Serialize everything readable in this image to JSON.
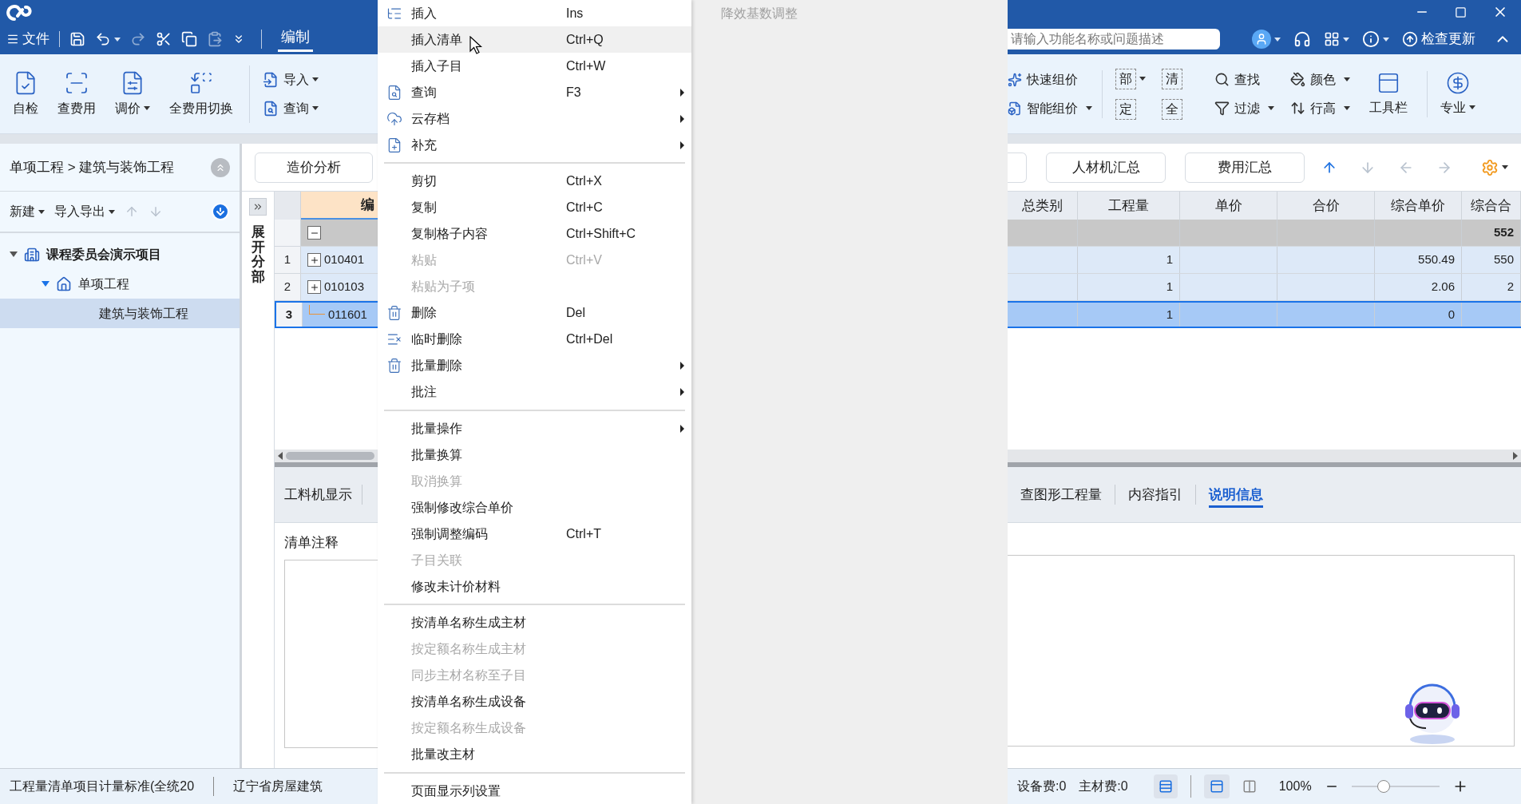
{
  "title_bar": {
    "file_menu": "文件",
    "tabs": [
      {
        "label": "编制",
        "selected": true
      }
    ],
    "search": {
      "placeholder": "请输入功能名称或问题描述"
    },
    "update_label": "检查更新"
  },
  "ribbon_left": {
    "large": [
      {
        "label": "自检",
        "dropdown": false
      },
      {
        "label": "查费用",
        "dropdown": false
      },
      {
        "label": "调价",
        "dropdown": true
      },
      {
        "label": "全费用切换",
        "dropdown": false
      }
    ],
    "small": [
      {
        "label": "导入",
        "dropdown": true
      },
      {
        "label": "查询",
        "dropdown": true
      }
    ]
  },
  "ribbon_right": {
    "small": [
      {
        "label": "快速组价",
        "dropdown": false
      },
      {
        "label": "智能组价",
        "dropdown": true
      }
    ],
    "glyphs": [
      {
        "label": "部",
        "dropdown": true
      },
      {
        "label": "清",
        "dropdown": false
      },
      {
        "label": "定",
        "dropdown": false
      },
      {
        "label": "全",
        "dropdown": false
      }
    ],
    "tools": [
      {
        "label": "查找",
        "dropdown": false
      },
      {
        "label": "颜色",
        "dropdown": true
      },
      {
        "label": "过滤",
        "dropdown": true
      },
      {
        "label": "行高",
        "dropdown": true
      }
    ],
    "large": [
      {
        "label": "工具栏",
        "dropdown": false
      },
      {
        "label": "专业",
        "dropdown": true
      }
    ]
  },
  "project_panel": {
    "breadcrumb": "单项工程 > 建筑与装饰工程",
    "toolbar": [
      {
        "label": "新建"
      },
      {
        "label": "导入导出"
      }
    ],
    "tree": [
      {
        "label": "课程委员会演示项目",
        "expanded": true,
        "selected": false,
        "children": [
          {
            "label": "单项工程",
            "expanded": true,
            "selected": false,
            "children": [
              {
                "label": "建筑与装饰工程",
                "selected": true
              }
            ]
          }
        ]
      }
    ]
  },
  "analysis_button": "造价分析",
  "expand_label": "展开分部",
  "summary_buttons": [
    "人材机汇总",
    "费用汇总"
  ],
  "grid": {
    "columns": {
      "code": "编",
      "category": "总类别",
      "qty": "工程量",
      "unit_price": "单价",
      "total": "合价",
      "composite_unit_price": "综合单价",
      "composite_total": "综合合"
    },
    "rows": [
      {
        "kind": "section",
        "expanded": true,
        "selected": false,
        "composite_total": "552"
      },
      {
        "kind": "item",
        "num": "1",
        "code": "010401",
        "expanded": false,
        "selected": false,
        "qty": "1",
        "composite_unit_price": "550.49",
        "composite_total": "550"
      },
      {
        "kind": "item",
        "num": "2",
        "code": "010103",
        "expanded": false,
        "selected": false,
        "qty": "1",
        "composite_unit_price": "2.06",
        "composite_total": "2"
      },
      {
        "kind": "item",
        "num": "3",
        "code": "011601",
        "selected": true,
        "qty": "1",
        "composite_unit_price": "0"
      }
    ]
  },
  "context_menu": [
    {
      "kind": "item",
      "label": "插入",
      "shortcut": "Ins",
      "disabled": false,
      "submenu": false,
      "selected": false
    },
    {
      "kind": "item",
      "label": "插入清单",
      "shortcut": "Ctrl+Q",
      "disabled": false,
      "submenu": false,
      "selected": true
    },
    {
      "kind": "item",
      "label": "插入子目",
      "shortcut": "Ctrl+W",
      "disabled": false,
      "submenu": false,
      "selected": false
    },
    {
      "kind": "item",
      "label": "查询",
      "shortcut": "F3",
      "disabled": false,
      "submenu": true,
      "selected": false
    },
    {
      "kind": "item",
      "label": "云存档",
      "disabled": false,
      "submenu": true,
      "selected": false
    },
    {
      "kind": "item",
      "label": "补充",
      "disabled": false,
      "submenu": true,
      "selected": false
    },
    {
      "kind": "separator"
    },
    {
      "kind": "item",
      "label": "剪切",
      "shortcut": "Ctrl+X",
      "disabled": false,
      "submenu": false,
      "selected": false
    },
    {
      "kind": "item",
      "label": "复制",
      "shortcut": "Ctrl+C",
      "disabled": false,
      "submenu": false,
      "selected": false
    },
    {
      "kind": "item",
      "label": "复制格子内容",
      "shortcut": "Ctrl+Shift+C",
      "disabled": false,
      "submenu": false,
      "selected": false
    },
    {
      "kind": "item",
      "label": "粘贴",
      "shortcut": "Ctrl+V",
      "disabled": true,
      "submenu": false,
      "selected": false
    },
    {
      "kind": "item",
      "label": "粘贴为子项",
      "disabled": true,
      "submenu": false,
      "selected": false
    },
    {
      "kind": "item",
      "label": "删除",
      "shortcut": "Del",
      "disabled": false,
      "submenu": false,
      "selected": false
    },
    {
      "kind": "item",
      "label": "临时删除",
      "shortcut": "Ctrl+Del",
      "disabled": false,
      "submenu": false,
      "selected": false
    },
    {
      "kind": "item",
      "label": "批量删除",
      "disabled": false,
      "submenu": true,
      "selected": false
    },
    {
      "kind": "item",
      "label": "批注",
      "disabled": false,
      "submenu": true,
      "selected": false
    },
    {
      "kind": "separator"
    },
    {
      "kind": "item",
      "label": "批量操作",
      "disabled": false,
      "submenu": true,
      "selected": false
    },
    {
      "kind": "item",
      "label": "批量换算",
      "disabled": false,
      "submenu": false,
      "selected": false
    },
    {
      "kind": "item",
      "label": "取消换算",
      "disabled": true,
      "submenu": false,
      "selected": false
    },
    {
      "kind": "item",
      "label": "强制修改综合单价",
      "disabled": false,
      "submenu": false,
      "selected": false
    },
    {
      "kind": "item",
      "label": "强制调整编码",
      "shortcut": "Ctrl+T",
      "disabled": false,
      "submenu": false,
      "selected": false
    },
    {
      "kind": "item",
      "label": "子目关联",
      "disabled": true,
      "submenu": false,
      "selected": false
    },
    {
      "kind": "item",
      "label": "修改未计价材料",
      "disabled": false,
      "submenu": false,
      "selected": false
    },
    {
      "kind": "separator"
    },
    {
      "kind": "item",
      "label": "按清单名称生成主材",
      "disabled": false,
      "submenu": false,
      "selected": false
    },
    {
      "kind": "item",
      "label": "按定额名称生成主材",
      "disabled": true,
      "submenu": false,
      "selected": false
    },
    {
      "kind": "item",
      "label": "同步主材名称至子目",
      "disabled": true,
      "submenu": false,
      "selected": false
    },
    {
      "kind": "item",
      "label": "按清单名称生成设备",
      "disabled": false,
      "submenu": false,
      "selected": false
    },
    {
      "kind": "item",
      "label": "按定额名称生成设备",
      "disabled": true,
      "submenu": false,
      "selected": false
    },
    {
      "kind": "item",
      "label": "批量改主材",
      "disabled": false,
      "submenu": false,
      "selected": false
    },
    {
      "kind": "separator"
    },
    {
      "kind": "item",
      "label": "页面显示列设置",
      "disabled": false,
      "submenu": false,
      "selected": false
    }
  ],
  "side_menu": {
    "label": "降效基数调整",
    "disabled": true
  },
  "bottom_tabs_left": [
    {
      "label": "工料机显示",
      "selected": false
    }
  ],
  "bottom_tabs_right": [
    {
      "label": "查图形工程量",
      "selected": false
    },
    {
      "label": "内容指引",
      "selected": false
    },
    {
      "label": "说明信息",
      "selected": true
    }
  ],
  "note_label": "清单注释",
  "status_bar": {
    "left": [
      "工程量清单项目计量标准(全统20",
      "辽宁省房屋建筑"
    ],
    "right": [
      "设备费:0",
      "主材费:0"
    ],
    "zoom": "100%",
    "zoom_slider": {
      "level": 0.37
    }
  }
}
